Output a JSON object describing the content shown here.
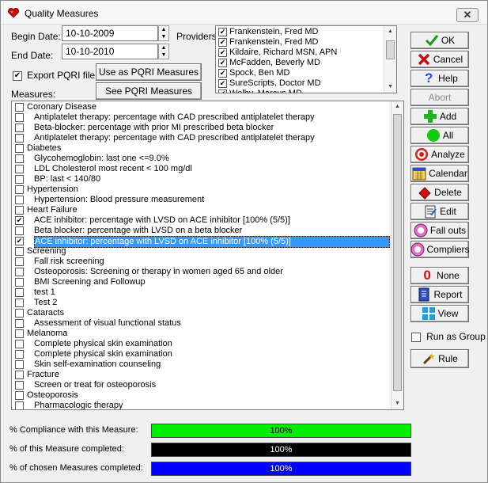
{
  "window": {
    "title": "Quality Measures",
    "close_glyph": "✕"
  },
  "dates": {
    "begin_label": "Begin Date:",
    "begin_value": "10-10-2009",
    "end_label": "End Date:",
    "end_value": "10-10-2010"
  },
  "export": {
    "label": "Export PQRI file",
    "checked": true
  },
  "buttons_mid": {
    "use_pqri": "Use as PQRI  Measures",
    "see_pqri": "See PQRI Measures"
  },
  "providers": {
    "label": "Providers:",
    "items": [
      {
        "name": "Frankenstein, Fred MD",
        "checked": true
      },
      {
        "name": "Frankenstein, Fred MD",
        "checked": true
      },
      {
        "name": "Kildaire, Richard MSN, APN",
        "checked": true
      },
      {
        "name": "McFadden, Beverly MD",
        "checked": true
      },
      {
        "name": "Spock, Ben MD",
        "checked": true
      },
      {
        "name": "SureScripts, Doctor MD",
        "checked": true
      },
      {
        "name": "Welby, Marcus MD",
        "checked": true
      }
    ]
  },
  "measures": {
    "label": "Measures:",
    "rows": [
      {
        "text": "Coronary Disease",
        "indent": 0,
        "checked": false
      },
      {
        "text": "Antiplatelet therapy: percentage with CAD prescribed antiplatelet therapy",
        "indent": 1,
        "checked": false
      },
      {
        "text": "Beta-blocker: percentage with prior MI prescribed beta blocker",
        "indent": 1,
        "checked": false
      },
      {
        "text": "Antiplatelet therapy: percentage with CAD prescribed antiplatelet therapy",
        "indent": 1,
        "checked": false
      },
      {
        "text": "Diabetes",
        "indent": 0,
        "checked": false
      },
      {
        "text": "Glycohemoglobin: last one <=9.0%",
        "indent": 1,
        "checked": false
      },
      {
        "text": "LDL Cholesterol most recent < 100 mg/dl",
        "indent": 1,
        "checked": false
      },
      {
        "text": "BP: last < 140/80",
        "indent": 1,
        "checked": false
      },
      {
        "text": "Hypertension",
        "indent": 0,
        "checked": false
      },
      {
        "text": "Hypertension: Blood pressure measurement",
        "indent": 1,
        "checked": false
      },
      {
        "text": "Heart Failure",
        "indent": 0,
        "checked": false
      },
      {
        "text": "ACE inhibitor: percentage with LVSD on ACE inhibitor      [100% (5/5)]",
        "indent": 1,
        "checked": true
      },
      {
        "text": "Beta blocker: percentage with LVSD on a beta blocker",
        "indent": 1,
        "checked": false
      },
      {
        "text": "ACE inhibitor: percentage with LVSD on ACE inhibitor  [100% (5/5)]",
        "indent": 1,
        "checked": true,
        "selected": true
      },
      {
        "text": "Screening",
        "indent": 0,
        "checked": false
      },
      {
        "text": "Fall risk screening",
        "indent": 1,
        "checked": false
      },
      {
        "text": "Osteoporosis: Screening or therapy in women aged 65 and older",
        "indent": 1,
        "checked": false
      },
      {
        "text": "BMI Screening and Followup",
        "indent": 1,
        "checked": false
      },
      {
        "text": "test 1",
        "indent": 1,
        "checked": false
      },
      {
        "text": "Test 2",
        "indent": 1,
        "checked": false
      },
      {
        "text": "Cataracts",
        "indent": 0,
        "checked": false
      },
      {
        "text": "Assessment of visual functional status",
        "indent": 1,
        "checked": false
      },
      {
        "text": "Melanoma",
        "indent": 0,
        "checked": false
      },
      {
        "text": "Complete physical skin examination",
        "indent": 1,
        "checked": false
      },
      {
        "text": "Complete physical skin examination",
        "indent": 1,
        "checked": false
      },
      {
        "text": "Skin self-examination counseling",
        "indent": 1,
        "checked": false
      },
      {
        "text": "Fracture",
        "indent": 0,
        "checked": false
      },
      {
        "text": "Screen or treat for osteoporosis",
        "indent": 1,
        "checked": false
      },
      {
        "text": "Osteoporosis",
        "indent": 0,
        "checked": false
      },
      {
        "text": "Pharmacologic therapy",
        "indent": 1,
        "checked": false
      }
    ]
  },
  "right_buttons": {
    "ok": "OK",
    "cancel": "Cancel",
    "help": "Help",
    "abort": "Abort",
    "add": "Add",
    "all": "All",
    "analyze": "Analyze",
    "calendar": "Calendar",
    "delete": "Delete",
    "edit": "Edit",
    "fall_outs": "Fall outs",
    "compliers": "Compliers",
    "none": "None",
    "report": "Report",
    "view": "View",
    "run_as_group": "Run as Group",
    "rule": "Rule"
  },
  "progress": {
    "compliance_label": "% Compliance with this Measure:",
    "compliance_value": "100%",
    "compliance_fraction": 1.0,
    "compliance_color": "#00ee00",
    "measure_label": "% of this Measure completed:",
    "measure_value": "100%",
    "measure_fraction": 1.0,
    "measure_color": "#000000",
    "chosen_label": "% of chosen Measures completed:",
    "chosen_value": "100%",
    "chosen_fraction": 1.0,
    "chosen_color": "#0000ff"
  }
}
